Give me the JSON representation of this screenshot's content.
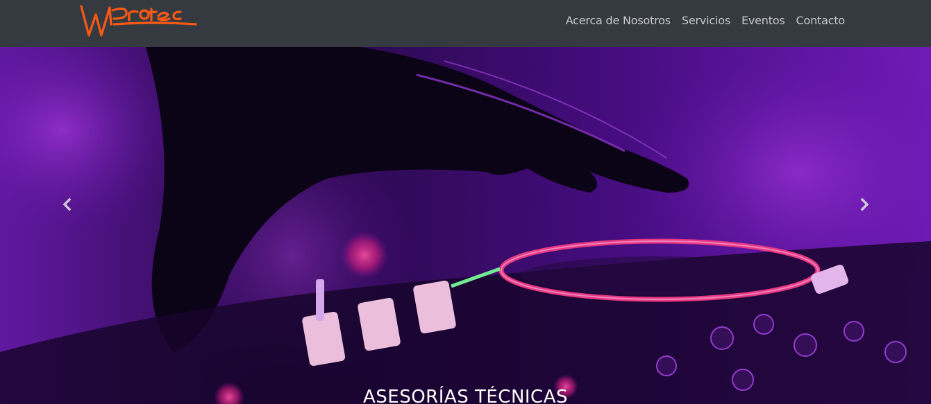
{
  "brand": {
    "logo_text": "WProtec",
    "logo_color": "#ff5a14"
  },
  "nav": {
    "items": [
      {
        "label": "Acerca de Nosotros"
      },
      {
        "label": "Servicios"
      },
      {
        "label": "Eventos"
      },
      {
        "label": "Contacto"
      }
    ],
    "background": "#343a40",
    "text_color": "#c7c9cc"
  },
  "carousel": {
    "prev_icon": "chevron-left-icon",
    "next_icon": "chevron-right-icon",
    "slide": {
      "image": "dj-mixer-purple-lights",
      "caption": "ASESORÍAS TÉCNICAS"
    }
  }
}
